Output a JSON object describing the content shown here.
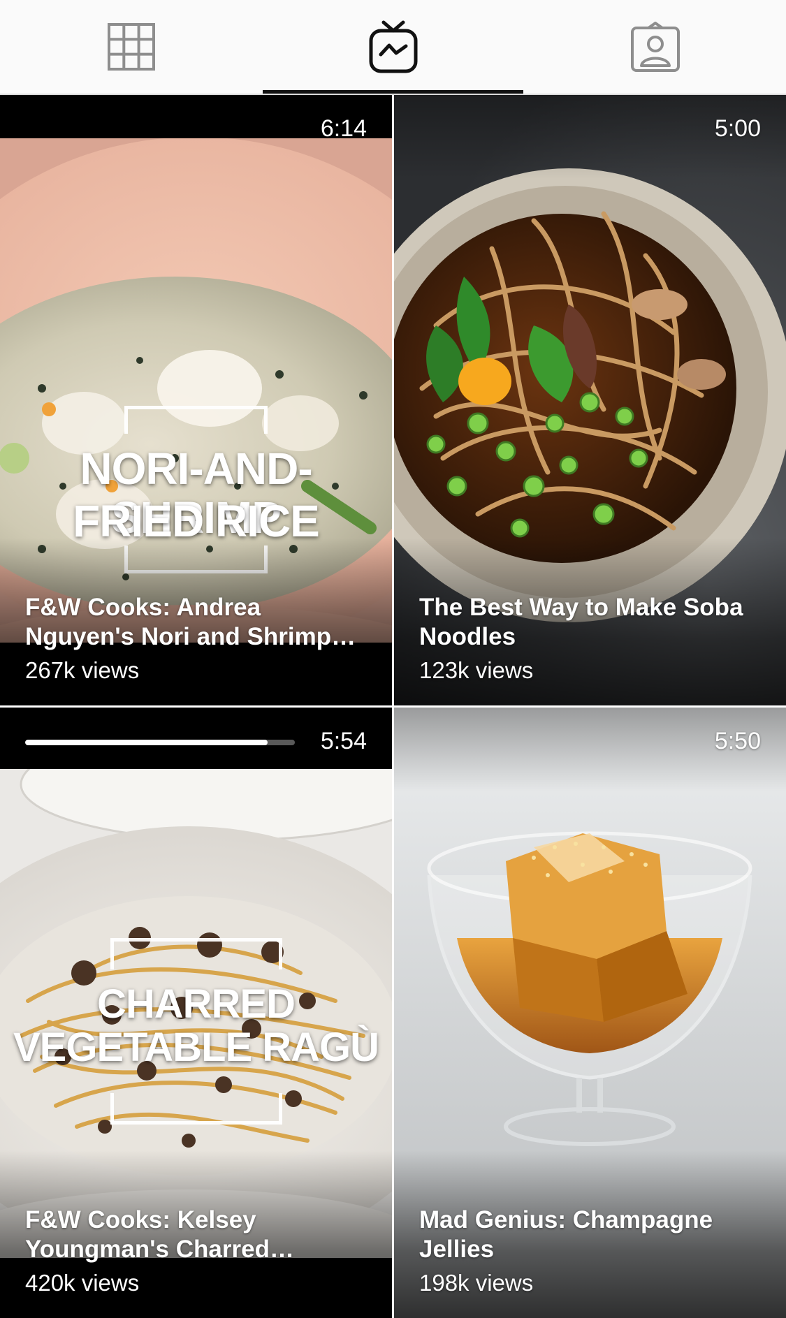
{
  "tabs": [
    {
      "icon": "grid-icon",
      "active": false
    },
    {
      "icon": "igtv-icon",
      "active": true
    },
    {
      "icon": "tagged-icon",
      "active": false
    }
  ],
  "videos": [
    {
      "duration": "6:14",
      "title": "F&W Cooks: Andrea Nguyen's Nori and Shrimp Fried Rice",
      "views": "267k views",
      "overlay_lines": [
        "NORI-AND-SHRIMP",
        "FRIED RICE"
      ]
    },
    {
      "duration": "5:00",
      "title": "The Best Way to Make Soba Noodles",
      "views": "123k views"
    },
    {
      "duration": "5:54",
      "title": "F&W Cooks: Kelsey Youngman's Charred Vegetable Ragù",
      "views": "420k views",
      "overlay_lines": [
        "CHARRED",
        "VEGETABLE RAGÙ"
      ],
      "watched_fraction": 0.9
    },
    {
      "duration": "5:50",
      "title": "Mad Genius: Champagne Jellies",
      "views": "198k views"
    }
  ]
}
